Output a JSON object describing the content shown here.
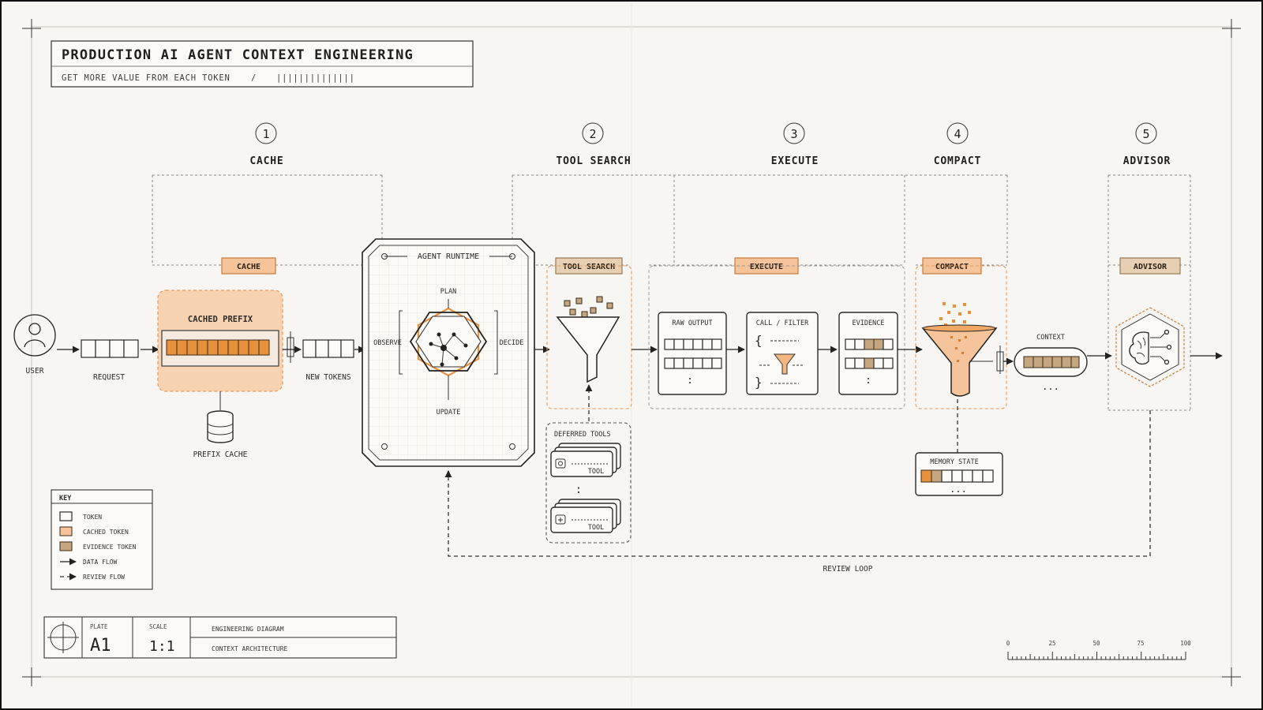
{
  "title": "PRODUCTION AI AGENT CONTEXT ENGINEERING",
  "subtitle": "GET MORE VALUE FROM EACH TOKEN",
  "subtitle_sep": "/",
  "subtitle_ticks": "||||||||||||||",
  "stages": [
    {
      "num": "1",
      "label": "CACHE"
    },
    {
      "num": "2",
      "label": "TOOL SEARCH"
    },
    {
      "num": "3",
      "label": "EXECUTE"
    },
    {
      "num": "4",
      "label": "COMPACT"
    },
    {
      "num": "5",
      "label": "ADVISOR"
    }
  ],
  "tags": {
    "cache": "CACHE",
    "tool_search": "TOOL SEARCH",
    "execute": "EXECUTE",
    "compact": "COMPACT",
    "advisor": "ADVISOR"
  },
  "user": "USER",
  "request": "REQUEST",
  "cached_prefix": "CACHED PREFIX",
  "prefix_cache": "PREFIX CACHE",
  "new_tokens": "NEW TOKENS",
  "runtime": {
    "title": "AGENT RUNTIME",
    "plan": "PLAN",
    "observe": "OBSERVE",
    "decide": "DECIDE",
    "update": "UPDATE"
  },
  "deferred": {
    "title": "DEFERRED TOOLS",
    "tool1": "TOOL",
    "tool2": "TOOL",
    "ellipsis": ":"
  },
  "execute": {
    "raw_output": "RAW OUTPUT",
    "call_filter": "CALL / FILTER",
    "evidence": "EVIDENCE",
    "dots": ":",
    "brace_open": "{",
    "brace_close": "}"
  },
  "context": "CONTEXT",
  "context_dots": "...",
  "memory_state": "MEMORY STATE",
  "memory_dots": "...",
  "review_loop": "REVIEW LOOP",
  "key": {
    "title": "KEY",
    "items": [
      "TOKEN",
      "CACHED TOKEN",
      "EVIDENCE TOKEN",
      "DATA FLOW",
      "REVIEW FLOW"
    ]
  },
  "plate": {
    "plate_label": "PLATE",
    "plate_value": "A1",
    "scale_label": "SCALE",
    "scale_value": "1:1",
    "line1": "ENGINEERING DIAGRAM",
    "line2": "CONTEXT ARCHITECTURE"
  },
  "scale_ticks": [
    "0",
    "25",
    "50",
    "75",
    "100"
  ],
  "colors": {
    "cached": "#e8913c",
    "evidence": "#c4a681",
    "tag": "#f6c49b",
    "background": "#f7f6f2"
  }
}
